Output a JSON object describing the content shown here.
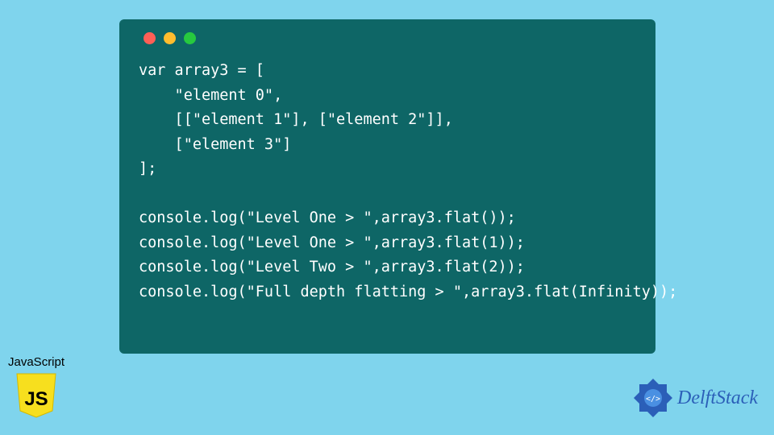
{
  "code": {
    "lines": [
      "var array3 = [",
      "    \"element 0\",",
      "    [[\"element 1\"], [\"element 2\"]],",
      "    [\"element 3\"]",
      "];",
      "",
      "console.log(\"Level One > \",array3.flat());",
      "console.log(\"Level One > \",array3.flat(1));",
      "console.log(\"Level Two > \",array3.flat(2));",
      "console.log(\"Full depth flatting > \",array3.flat(Infinity));"
    ]
  },
  "js_badge": {
    "label": "JavaScript",
    "icon_text": "JS"
  },
  "delft": {
    "name": "DelftStack"
  }
}
